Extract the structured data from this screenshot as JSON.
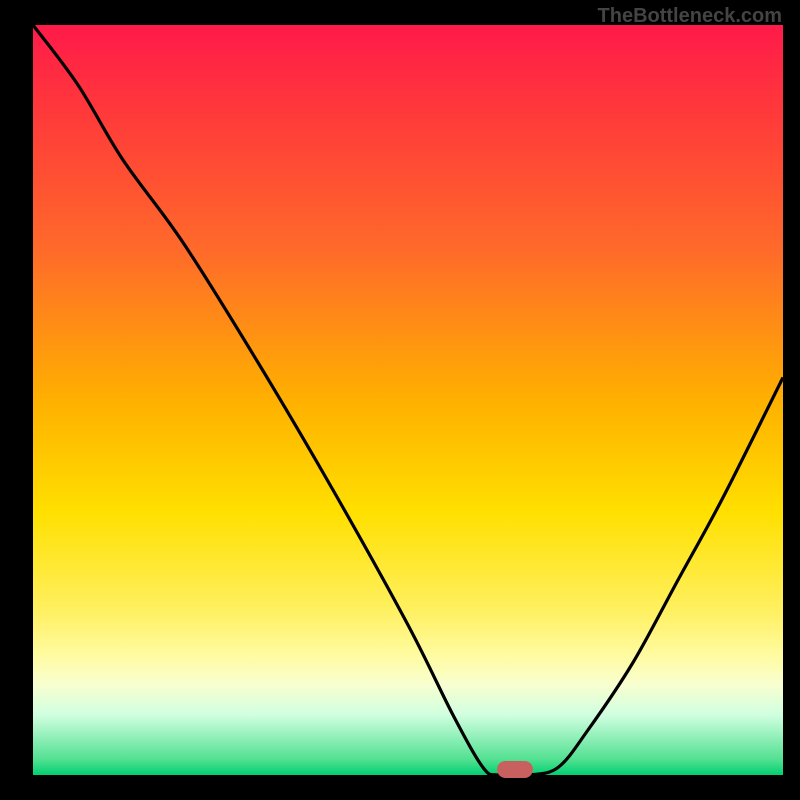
{
  "watermark": "TheBottleneck.com",
  "chart_data": {
    "type": "line",
    "title": "",
    "xlabel": "",
    "ylabel": "",
    "xlim": [
      0,
      1
    ],
    "ylim": [
      0,
      1
    ],
    "x": [
      0.0,
      0.06,
      0.12,
      0.2,
      0.3,
      0.4,
      0.5,
      0.56,
      0.6,
      0.62,
      0.66,
      0.7,
      0.74,
      0.8,
      0.86,
      0.92,
      1.0
    ],
    "y": [
      1.0,
      0.92,
      0.82,
      0.71,
      0.55,
      0.38,
      0.2,
      0.08,
      0.01,
      0.0,
      0.0,
      0.01,
      0.06,
      0.15,
      0.26,
      0.37,
      0.53
    ],
    "marker": {
      "x": 0.643,
      "y": 0.0
    },
    "gradient_stops": [
      {
        "pos": 0.0,
        "color": "#ff1a4a"
      },
      {
        "pos": 0.5,
        "color": "#ffe000"
      },
      {
        "pos": 0.9,
        "color": "#fffba0"
      },
      {
        "pos": 1.0,
        "color": "#00d070"
      }
    ],
    "legend": [],
    "grid": false
  }
}
